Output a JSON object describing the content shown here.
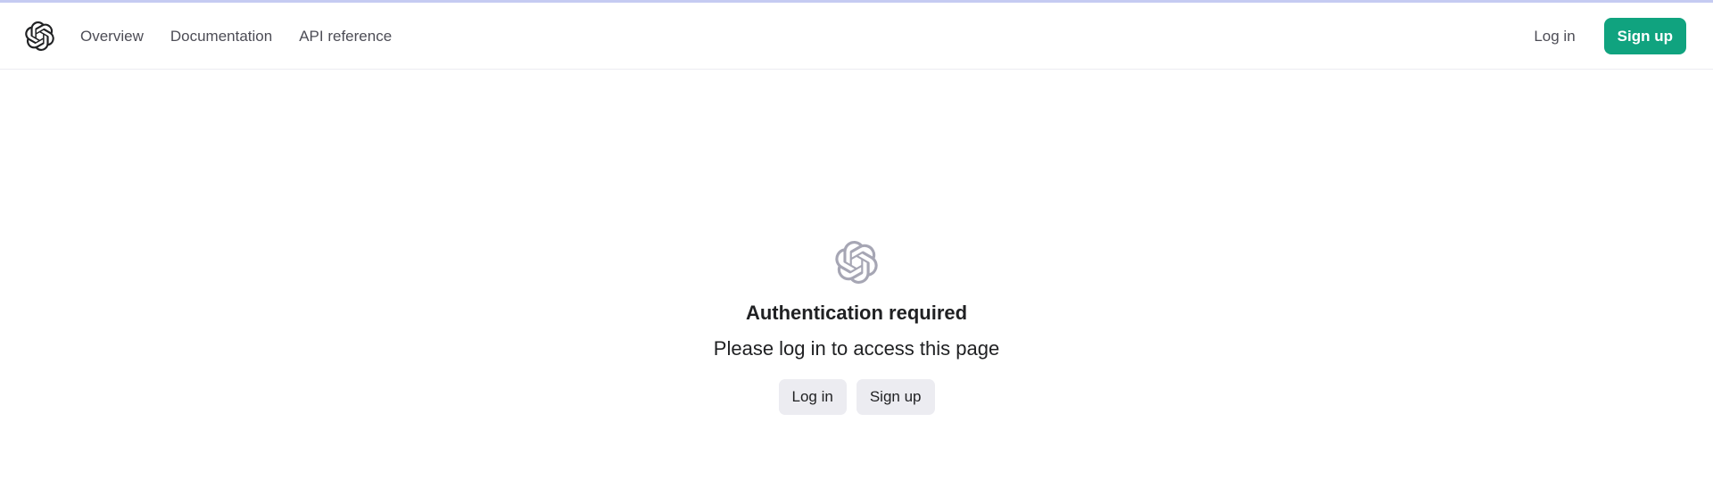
{
  "navbar": {
    "logo_icon": "openai-logo-icon",
    "links": [
      "Overview",
      "Documentation",
      "API reference"
    ],
    "login_label": "Log in",
    "signup_label": "Sign up"
  },
  "auth": {
    "logo_icon": "openai-logo-icon",
    "title": "Authentication required",
    "subtitle": "Please log in to access this page",
    "login_label": "Log in",
    "signup_label": "Sign up"
  },
  "colors": {
    "accent": "#10a37f",
    "button_secondary_bg": "#ececf1",
    "text": "#202123",
    "nav_text": "#4d4d56",
    "center_logo": "#a6a6b4",
    "top_accent": "#c5cbf2"
  }
}
